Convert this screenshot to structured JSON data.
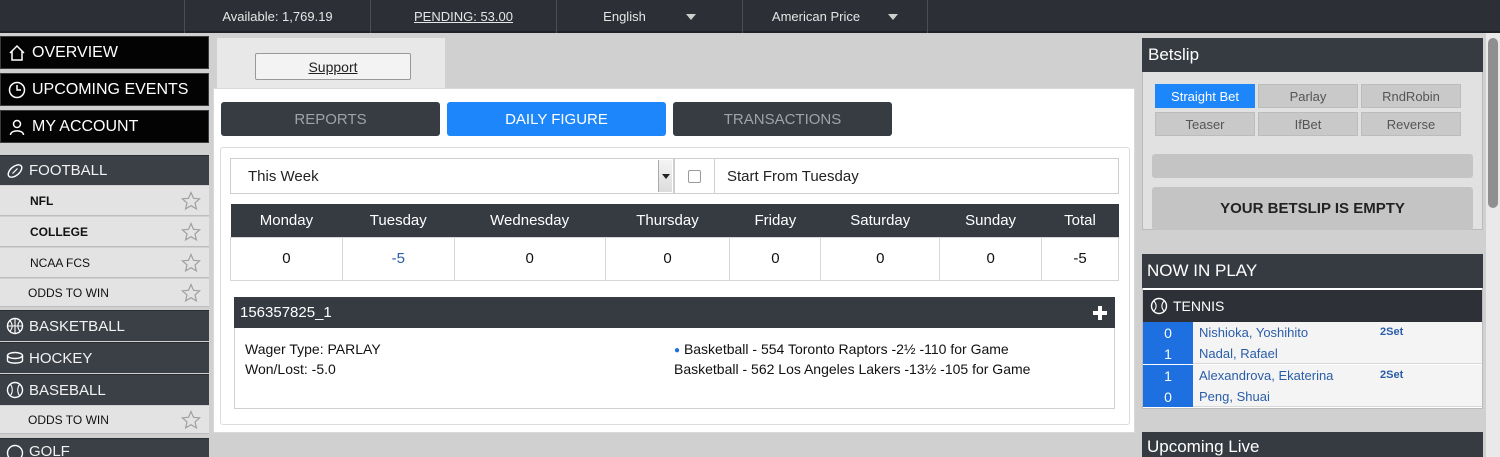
{
  "topbar": {
    "available": "Available: 1,769.19",
    "pending": "PENDING: 53.00",
    "language": "English",
    "price_format": "American Price"
  },
  "nav": {
    "overview": "OVERVIEW",
    "upcoming": "UPCOMING EVENTS",
    "account": "MY ACCOUNT"
  },
  "sports": {
    "football": "FOOTBALL",
    "football_items": [
      "NFL",
      "COLLEGE",
      "NCAA FCS",
      "ODDS TO WIN"
    ],
    "basketball": "BASKETBALL",
    "hockey": "HOCKEY",
    "baseball": "BASEBALL",
    "baseball_items": [
      "ODDS TO WIN"
    ],
    "golf": "GOLF"
  },
  "support": "Support",
  "tabs": [
    "REPORTS",
    "DAILY FIGURE",
    "TRANSACTIONS"
  ],
  "filter": {
    "period": "This Week",
    "start_label": "Start From Tuesday"
  },
  "figures": {
    "headers": [
      "Monday",
      "Tuesday",
      "Wednesday",
      "Thursday",
      "Friday",
      "Saturday",
      "Sunday",
      "Total"
    ],
    "values": [
      "0",
      "-5",
      "0",
      "0",
      "0",
      "0",
      "0",
      "-5"
    ]
  },
  "wager": {
    "id": "156357825_1",
    "type": "Wager Type: PARLAY",
    "result": "Won/Lost: -5.0",
    "legs": [
      "Basketball - 554 Toronto Raptors -2½ -110 for Game",
      "Basketball - 562 Los Angeles Lakers -13½ -105 for Game"
    ]
  },
  "betslip": {
    "title": "Betslip",
    "types": [
      "Straight Bet",
      "Parlay",
      "RndRobin",
      "Teaser",
      "IfBet",
      "Reverse"
    ],
    "empty": "YOUR BETSLIP IS EMPTY"
  },
  "now_in_play": {
    "title": "NOW IN PLAY",
    "sport": "TENNIS",
    "matches": [
      {
        "set": "2Set",
        "players": [
          {
            "score": "0",
            "name": "Nishioka, Yoshihito"
          },
          {
            "score": "1",
            "name": "Nadal, Rafael"
          }
        ]
      },
      {
        "set": "2Set",
        "players": [
          {
            "score": "1",
            "name": "Alexandrova, Ekaterina"
          },
          {
            "score": "0",
            "name": "Peng, Shuai"
          }
        ]
      }
    ]
  },
  "upcoming_live": "Upcoming Live",
  "colors": {
    "accent": "#1e86fb",
    "header": "#363b42",
    "link": "#2a5da8"
  }
}
